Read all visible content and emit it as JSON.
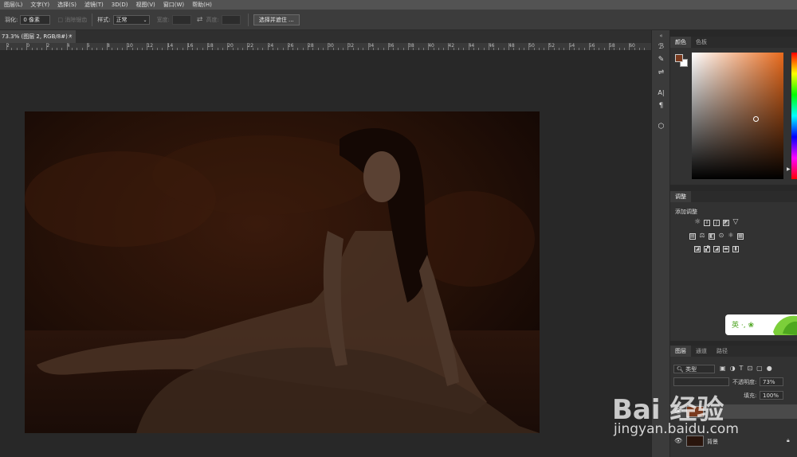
{
  "menubar": {
    "items": [
      "图层(L)",
      "文字(Y)",
      "选择(S)",
      "滤镜(T)",
      "3D(D)",
      "视图(V)",
      "窗口(W)",
      "帮助(H)"
    ]
  },
  "options": {
    "feather_label": "羽化:",
    "feather_value": "0 像素",
    "antialias_label": "消除锯齿",
    "style_label": "样式:",
    "style_value": "正常",
    "width_label": "宽度:",
    "height_label": "高度:",
    "select_mask_button": "选择并遮住 ..."
  },
  "document": {
    "tab_title": "73.3% (图层 2, RGB/8#) *",
    "close": "×"
  },
  "ruler": {
    "labels": [
      "2",
      "0",
      "2",
      "4",
      "6",
      "8",
      "10",
      "12",
      "14",
      "16",
      "18",
      "20",
      "22",
      "24",
      "26",
      "28",
      "30",
      "32",
      "34",
      "36",
      "38",
      "40",
      "42",
      "44",
      "46",
      "48",
      "50",
      "52",
      "54",
      "56",
      "58",
      "60"
    ]
  },
  "color_panel": {
    "tabs": [
      "颜色",
      "色板"
    ],
    "foreground": "#7a3a1e",
    "background": "#ffffff",
    "field_hue": "#e86a1c"
  },
  "adjust_panel": {
    "tabs": [
      "调整"
    ],
    "subtitle": "添加调整"
  },
  "layers_panel": {
    "tabs": [
      "图层",
      "通道",
      "路径"
    ],
    "filter_label": "类型",
    "blend_mode": "",
    "opacity_label": "不透明度:",
    "opacity_value": "73%",
    "fill_label": "填充:",
    "fill_value": "100%",
    "layers": [
      {
        "name": ""
      },
      {
        "name": "背景"
      }
    ]
  },
  "banner": {
    "text": "英 ·, ❀"
  },
  "watermark": {
    "brand": "Bai 经验",
    "url": "jingyan.baidu.com"
  }
}
